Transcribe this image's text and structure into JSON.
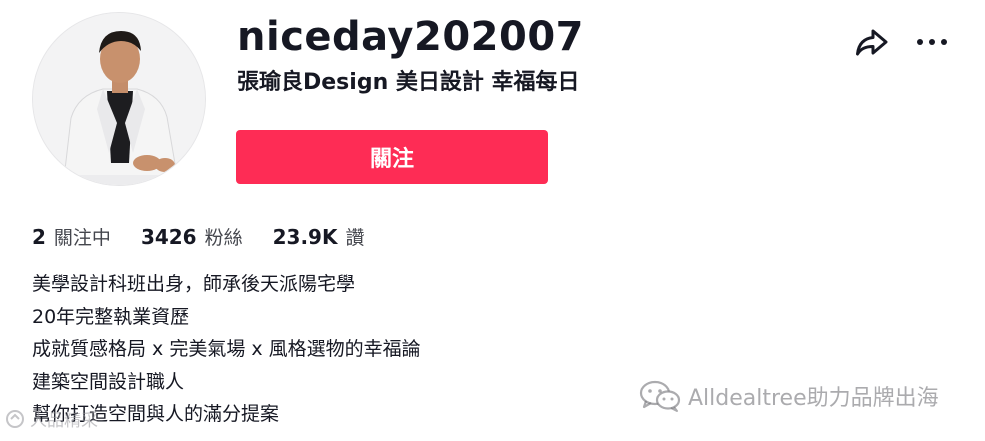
{
  "profile": {
    "username": "niceday202007",
    "nickname": "張瑜良Design 美日設計 幸福每日",
    "follow_label": "關注"
  },
  "stats": [
    {
      "value": "2",
      "label": "關注中"
    },
    {
      "value": "3426",
      "label": "粉絲"
    },
    {
      "value": "23.9K",
      "label": "讚"
    }
  ],
  "bio": [
    "美學設計科班出身，師承後天派陽宅學",
    "20年完整執業資歷",
    "成就質感格局 x 完美氣場 x 風格選物的幸福論",
    "建築空間設計職人",
    "幫你打造空間與人的滿分提案"
  ],
  "watermark": {
    "text": "Alldealtree助力品牌出海",
    "left_text": "人品精采"
  },
  "icons": {
    "share": "share-icon",
    "more": "more-icon",
    "wechat": "wechat-icon"
  },
  "colors": {
    "accent": "#fe2c55",
    "text": "#161823",
    "muted": "#44464d"
  }
}
